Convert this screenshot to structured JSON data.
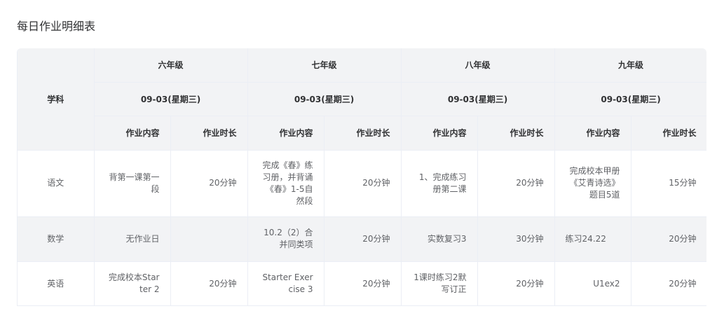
{
  "page": {
    "title": "每日作业明细表"
  },
  "table": {
    "subject_header": "学科",
    "grades": [
      {
        "name": "六年级",
        "date": "09-03(星期三)"
      },
      {
        "name": "七年级",
        "date": "09-03(星期三)"
      },
      {
        "name": "八年级",
        "date": "09-03(星期三)"
      },
      {
        "name": "九年级",
        "date": "09-03(星期三)"
      }
    ],
    "col_content": "作业内容",
    "col_duration": "作业时长",
    "rows": [
      {
        "subject": "语文",
        "cells": [
          {
            "content": "背第一课第一段",
            "duration": "20分钟"
          },
          {
            "content": "完成《春》练习册，并背诵《春》1-5自然段",
            "duration": "20分钟"
          },
          {
            "content": "1、完成练习册第二课",
            "duration": "20分钟"
          },
          {
            "content": "完成校本甲册《艾青诗选》题目5道",
            "duration": "15分钟"
          }
        ]
      },
      {
        "subject": "数学",
        "cells": [
          {
            "content": "无作业日",
            "duration": ""
          },
          {
            "content": "10.2（2）合并同类项",
            "duration": "20分钟"
          },
          {
            "content": "实数复习3",
            "duration": "30分钟"
          },
          {
            "content": "练习24.22",
            "duration": "20分钟"
          }
        ]
      },
      {
        "subject": "英语",
        "cells": [
          {
            "content": "完成校本Starter 2",
            "duration": "20分钟"
          },
          {
            "content": "Starter Exercise 3",
            "duration": "20分钟"
          },
          {
            "content": "1课时练习2默写订正",
            "duration": "20分钟"
          },
          {
            "content": "U1ex2",
            "duration": "20分钟"
          }
        ]
      }
    ]
  }
}
